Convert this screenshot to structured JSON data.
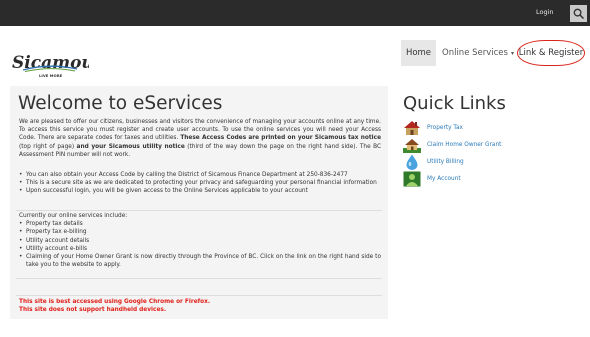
{
  "topbar": {
    "login_label": "Login"
  },
  "brand": {
    "name": "Sicamous",
    "tagline": "LIVE MORE"
  },
  "nav": {
    "home": "Home",
    "online_services": "Online Services",
    "link_register": "Link & Register"
  },
  "main": {
    "title": "Welcome to eServices",
    "intro_1": "We are pleased to offer our citizens, businesses and visitors the convenience of managing your accounts online at any time. To access this service you must register and create user accounts. To use the online services you will need your Access Code. There are separate codes for taxes and utilities.",
    "intro_bold_1": "These Access Codes are printed on your Sicamous tax notice",
    "intro_2": "(top right of page)",
    "intro_bold_2": "and your Sicamous utility notice",
    "intro_3": "(third of the way down the page on the right hand side). The BC Assessment PIN number will not work.",
    "bullets": [
      "You can also obtain your Access Code by calling the District of Sicamous Finance Department at 250-836-2477",
      "This is a secure site as we are dedicated to protecting your privacy and safeguarding your personal financial information",
      "Upon successful login, you will be given access to the Online Services applicable to your account"
    ],
    "services_intro": "Currently our online services include:",
    "services": [
      "Property tax details",
      "Property tax e-billing",
      "Utility account details",
      "Utility account e-bills",
      "Claiming of your Home Owner Grant is now directly through the Province of BC. Click on the link on the right hand side to take you to the website to apply."
    ],
    "warning_1": "This site is best accessed using Google Chrome or Firefox.",
    "warning_2": "This site does not support handheld devices."
  },
  "quick_links": {
    "title": "Quick Links",
    "items": [
      {
        "label": "Property Tax",
        "icon": "house-icon"
      },
      {
        "label": "Claim Home Owner Grant",
        "icon": "home-grant-icon"
      },
      {
        "label": "Utility Billing",
        "icon": "water-drop-icon"
      },
      {
        "label": "My Account",
        "icon": "account-icon"
      }
    ]
  },
  "colors": {
    "accent_link": "#2a7ab8",
    "warning": "#e0201a",
    "highlight_ring": "#d9261c"
  }
}
